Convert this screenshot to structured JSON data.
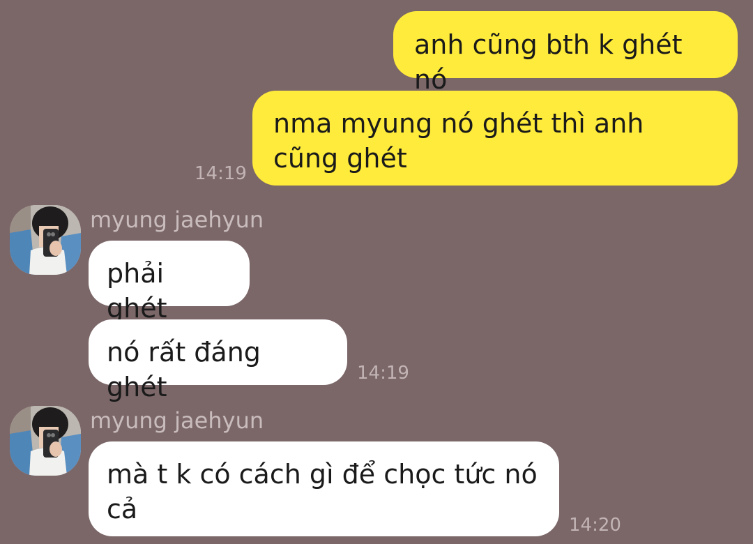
{
  "messages": [
    {
      "side": "out",
      "text": "anh cũng bth k ghét nó"
    },
    {
      "side": "out",
      "text": "nma myung nó ghét thì anh cũng ghét",
      "time": "14:19"
    },
    {
      "side": "in",
      "sender": "myung jaehyun",
      "text": "phải ghét"
    },
    {
      "side": "in",
      "text": "nó rất đáng ghét",
      "time": "14:19"
    },
    {
      "side": "in",
      "sender": "myung jaehyun",
      "text": "mà t k có cách gì để chọc tức nó cả",
      "time": "14:20"
    }
  ],
  "colors": {
    "background": "#7b6668",
    "outgoing_bubble": "#ffeb3b",
    "incoming_bubble": "#ffffff",
    "timestamp": "#c2b4b5",
    "sender_name": "#c9bcbd"
  }
}
